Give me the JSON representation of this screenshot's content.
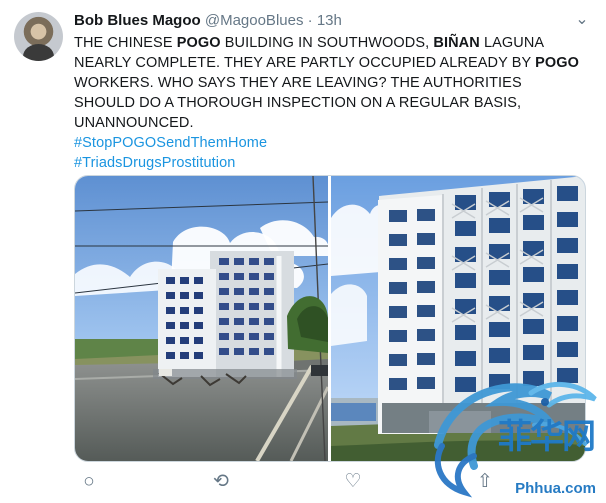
{
  "user": {
    "name": "Bob Blues Magoo",
    "handle": "@MagooBlues",
    "separator": "·",
    "time": "13h"
  },
  "tweet": {
    "line1": [
      "THE CHINESE ",
      "POGO",
      " BUILDING IN SOUTHWOODS, ",
      "BIÑAN",
      " LAGUNA"
    ],
    "line2": "NEARLY COMPLETE. THEY ARE PARTLY OCCUPIED ALREADY BY ",
    "line2_bold": "POGO",
    "line3": "WORKERS. WHO SAYS THEY ARE LEAVING? THE AUTHORITIES",
    "line4": "SHOULD DO A THOROUGH INSPECTION ON A REGULAR BASIS,",
    "line5": "UNANNOUNCED.",
    "hashtags": [
      "#StopPOGOSendThemHome",
      "#TriadsDrugsProstitution"
    ]
  },
  "actions": {
    "reply_icon": "reply-icon",
    "retweet_icon": "retweet-icon",
    "like_icon": "like-icon",
    "share_icon": "share-icon"
  },
  "watermark": {
    "chinese_text": "菲华网",
    "site": "Phhua.com",
    "colors": {
      "blue": "#1f7ac8",
      "light_blue": "#3b9bd4"
    }
  },
  "colors": {
    "text": "#14171a",
    "muted": "#657786",
    "link": "#1b95e0",
    "border": "#ccd6dd"
  }
}
